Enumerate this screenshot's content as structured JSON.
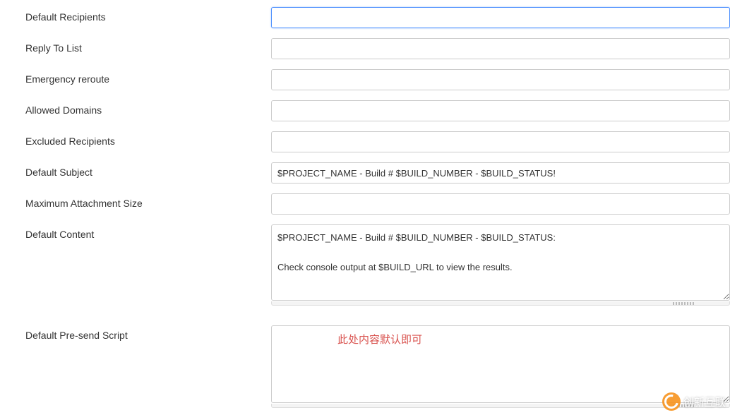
{
  "form": {
    "default_recipients": {
      "label": "Default Recipients",
      "value": ""
    },
    "reply_to_list": {
      "label": "Reply To List",
      "value": ""
    },
    "emergency_reroute": {
      "label": "Emergency reroute",
      "value": ""
    },
    "allowed_domains": {
      "label": "Allowed Domains",
      "value": ""
    },
    "excluded_recipients": {
      "label": "Excluded Recipients",
      "value": ""
    },
    "default_subject": {
      "label": "Default Subject",
      "value": "$PROJECT_NAME - Build # $BUILD_NUMBER - $BUILD_STATUS!"
    },
    "max_attachment_size": {
      "label": "Maximum Attachment Size",
      "value": ""
    },
    "default_content": {
      "label": "Default Content",
      "value": "$PROJECT_NAME - Build # $BUILD_NUMBER - $BUILD_STATUS:\n\nCheck console output at $BUILD_URL to view the results."
    },
    "default_presend_script": {
      "label": "Default Pre-send Script",
      "value": ""
    }
  },
  "annotation": {
    "text": "此处内容默认即可"
  },
  "branding": {
    "text": "创新互联"
  }
}
